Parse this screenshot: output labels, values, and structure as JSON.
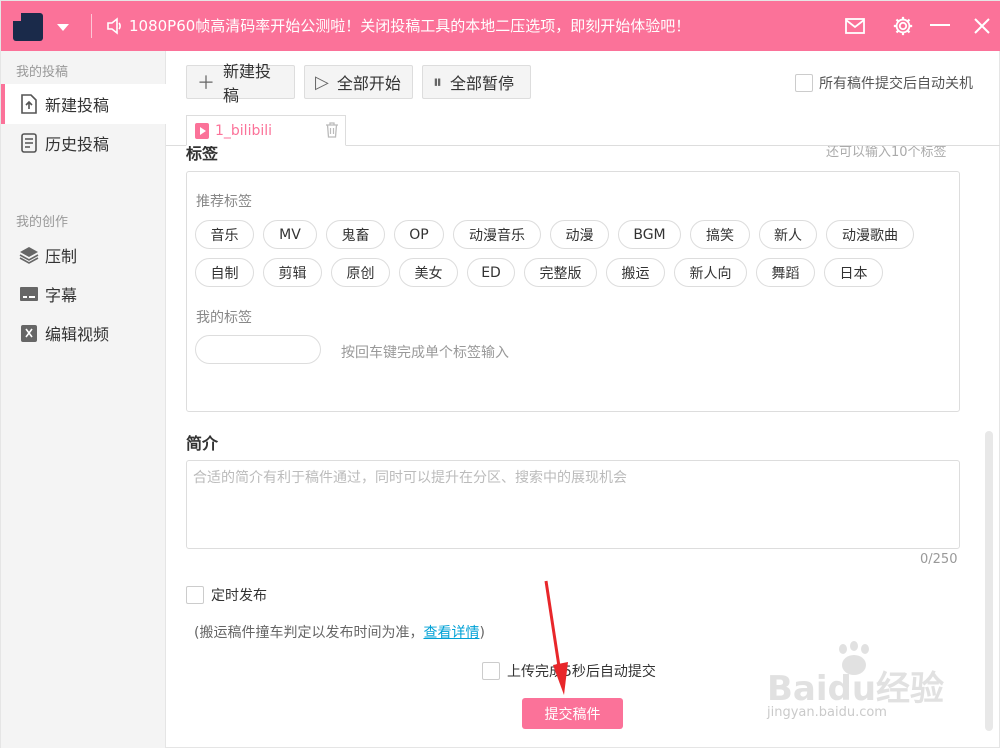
{
  "topbar": {
    "notice": "1080P60帧高清码率开始公测啦！关闭投稿工具的本地二压选项，即刻开始体验吧！",
    "icons": [
      "speaker-icon",
      "mail-icon",
      "gear-icon",
      "minimize-icon",
      "close-icon"
    ]
  },
  "sidebar": {
    "group1": "我的投稿",
    "group2": "我的创作",
    "items": [
      {
        "label": "新建投稿",
        "icon": "upload-file-icon"
      },
      {
        "label": "历史投稿",
        "icon": "history-icon"
      },
      {
        "label": "压制",
        "icon": "layers-icon"
      },
      {
        "label": "字幕",
        "icon": "subtitle-icon"
      },
      {
        "label": "编辑视频",
        "icon": "edit-video-icon"
      }
    ]
  },
  "toolbar": {
    "new_label": "新建投稿",
    "start_all_label": "全部开始",
    "pause_all_label": "全部暂停",
    "auto_shutdown_label": "所有稿件提交后自动关机"
  },
  "filetab": {
    "name": "1_bilibili"
  },
  "tags": {
    "title": "标签",
    "remaining_hint": "还可以输入10个标签",
    "recommended_label": "推荐标签",
    "row1": [
      "音乐",
      "MV",
      "鬼畜",
      "OP",
      "动漫音乐",
      "动漫",
      "BGM",
      "搞笑",
      "新人",
      "动漫歌曲"
    ],
    "row2": [
      "自制",
      "剪辑",
      "原创",
      "美女",
      "ED",
      "完整版",
      "搬运",
      "新人向",
      "舞蹈",
      "日本"
    ],
    "my_tags_label": "我的标签",
    "enter_hint": "按回车键完成单个标签输入"
  },
  "description": {
    "title": "简介",
    "placeholder": "合适的简介有利于稿件通过，同时可以提升在分区、搜索中的展现机会",
    "count": "0/250"
  },
  "schedule": {
    "label": "定时发布",
    "note_prefix": "(搬运稿件撞车判定以发布时间为准，",
    "note_link": "查看详情",
    "note_suffix": ")"
  },
  "auto_submit_label": "上传完成5秒后自动提交",
  "submit_label": "提交稿件",
  "watermark": {
    "text": "Baidu经验",
    "sub": "jingyan.baidu.com"
  },
  "colors": {
    "accent": "#fb7299",
    "link": "#00a1d6",
    "annotation_arrow": "#e8262a"
  }
}
